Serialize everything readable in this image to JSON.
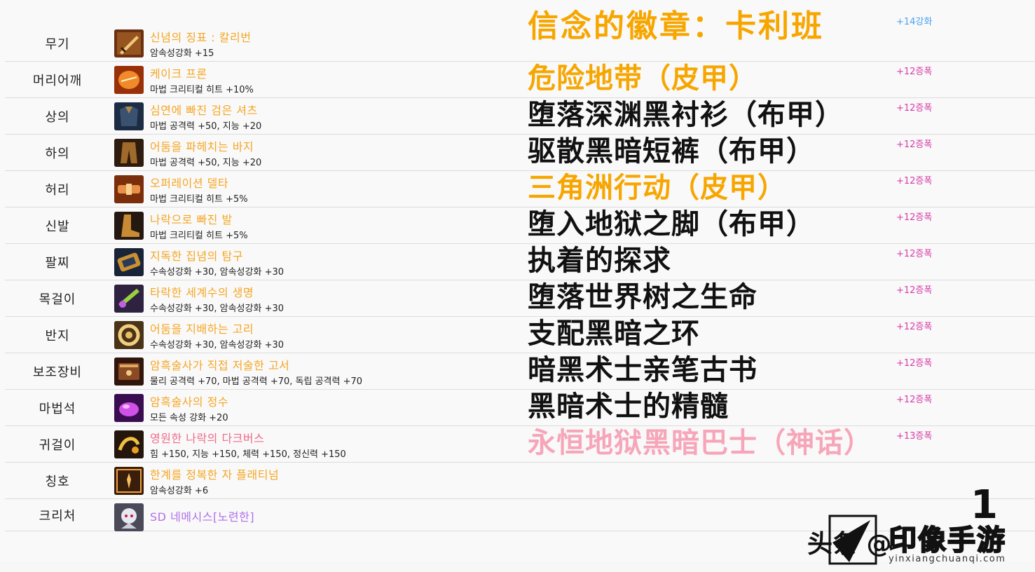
{
  "rows": [
    {
      "slot": "무기",
      "name": "신념의 징표 : 칼리번",
      "stat": "암속성강화 +15",
      "cn": "信念的徽章：卡利班",
      "enh": "+14강화",
      "icon": "sword-icon",
      "palette": [
        "#7a3b12",
        "#e8b25a"
      ]
    },
    {
      "slot": "머리어깨",
      "name": "케이크 프론",
      "stat": "마법 크리티컬 히트 +10%",
      "cn": "危险地带（皮甲）",
      "enh": "+12증폭",
      "icon": "shoulder-armor-icon",
      "palette": [
        "#b33a0c",
        "#f09030"
      ]
    },
    {
      "slot": "상의",
      "name": "심연에 빠진 검은 셔츠",
      "stat": "마법 공격력 +50, 지능 +20",
      "cn": "堕落深渊黑衬衫（布甲）",
      "enh": "+12증폭",
      "icon": "shirt-icon",
      "palette": [
        "#1f3550",
        "#8a6a3a"
      ]
    },
    {
      "slot": "하의",
      "name": "어둠을 파헤치는 바지",
      "stat": "마법 공격력 +50, 지능 +20",
      "cn": "驱散黑暗短裤（布甲）",
      "enh": "+12증폭",
      "icon": "pants-icon",
      "palette": [
        "#3a2414",
        "#c0843a"
      ]
    },
    {
      "slot": "허리",
      "name": "오퍼레이션 델타",
      "stat": "마법 크리티컬 히트 +5%",
      "cn": "三角洲行动（皮甲）",
      "enh": "+12증폭",
      "icon": "belt-icon",
      "palette": [
        "#8a3a10",
        "#f0a050"
      ]
    },
    {
      "slot": "신발",
      "name": "나락으로 빠진 발",
      "stat": "마법 크리티컬 히트 +5%",
      "cn": "堕入地狱之脚（布甲）",
      "enh": "+12증폭",
      "icon": "boots-icon",
      "palette": [
        "#2a1c10",
        "#d09a3a"
      ]
    },
    {
      "slot": "팔찌",
      "name": "지독한 집념의 탐구",
      "stat": "수속성강화 +30, 암속성강화 +30",
      "cn": "执着的探求",
      "enh": "+12증폭",
      "icon": "bracelet-icon",
      "palette": [
        "#1e2a40",
        "#c89030"
      ]
    },
    {
      "slot": "목걸이",
      "name": "타락한 세계수의 생명",
      "stat": "수속성강화 +30, 암속성강화 +30",
      "cn": "堕落世界树之生命",
      "enh": "+12증폭",
      "icon": "necklace-icon",
      "palette": [
        "#3a2a4a",
        "#9ad040"
      ]
    },
    {
      "slot": "반지",
      "name": "어둠을 지배하는 고리",
      "stat": "수속성강화 +30, 암속성강화 +30",
      "cn": "支配黑暗之环",
      "enh": "+12증폭",
      "icon": "ring-icon",
      "palette": [
        "#5a4020",
        "#f0d080"
      ]
    },
    {
      "slot": "보조장비",
      "name": "암흑술사가 직접 저술한 고서",
      "stat": "물리 공격력 +70, 마법 공격력 +70, 독립 공격력 +70",
      "cn": "暗黑术士亲笔古书",
      "enh": "+12증폭",
      "icon": "book-icon",
      "palette": [
        "#3a1a10",
        "#c08040"
      ]
    },
    {
      "slot": "마법석",
      "name": "암흑술사의 정수",
      "stat": "모든 속성 강화 +20",
      "cn": "黑暗术士的精髓",
      "enh": "+12증폭",
      "icon": "magic-stone-icon",
      "palette": [
        "#4a1060",
        "#e060f0"
      ]
    },
    {
      "slot": "귀걸이",
      "name": "영원한 나락의 다크버스",
      "stat": "힘 +150, 지능 +150, 체력 +150, 정신력 +150",
      "cn": "永恒地狱黑暗巴士（神话）",
      "enh": "+13증폭",
      "icon": "earring-icon",
      "palette": [
        "#2a1a10",
        "#f0c040"
      ]
    },
    {
      "slot": "칭호",
      "name": "한계를 정복한 자 플래티넘",
      "stat": "암속성강화 +6",
      "cn": "",
      "enh": "",
      "icon": "title-badge-icon",
      "palette": [
        "#3a2010",
        "#f0a040"
      ]
    },
    {
      "slot": "크리처",
      "name": "SD 네메시스[노련한]",
      "stat": "",
      "cn": "",
      "enh": "",
      "icon": "creature-icon",
      "palette": [
        "#5a5a6a",
        "#e8e8f0"
      ]
    }
  ],
  "watermark": {
    "left_text": "头条 @",
    "logo_text": "印像手游",
    "url": "yinxiangchuanqi.com",
    "number": "1"
  },
  "colors": {
    "name_orange": "#f5a623",
    "name_purple": "#b070e8",
    "name_pink": "#f06a8a",
    "enh_magenta": "#d63da8",
    "enh_blue": "#4aa3f0",
    "cn_orange": "#f7a600",
    "cn_pink": "#f6a6b8"
  }
}
